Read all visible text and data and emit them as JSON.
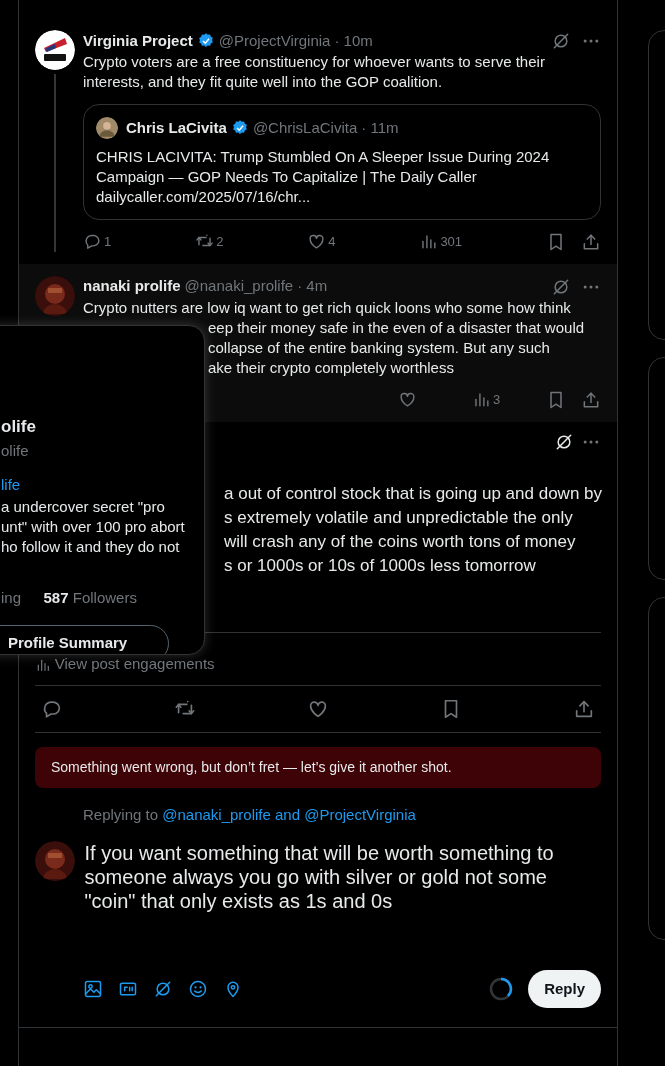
{
  "thread": [
    {
      "author": "Virginia Project",
      "verified": true,
      "handle": "@ProjectVirginia",
      "time": "· 10m",
      "highlighted": false,
      "text_lines": [
        "Crypto voters are a free constituency for whoever wants to serve their interests, and they fit quite well into the GOP coalition."
      ],
      "quote": {
        "author": "Chris LaCivita",
        "verified": true,
        "handle": "@ChrisLaCivita",
        "time": "· 11m",
        "text": "CHRIS LACIVITA: Trump Stumbled On A Sleeper Issue During 2024 Campaign — GOP Needs To Capitalize | The Daily Caller",
        "link": "dailycaller.com/2025/07/16/chr..."
      },
      "actions": [
        {
          "kind": "reply",
          "count": "1"
        },
        {
          "kind": "repost",
          "count": "2"
        },
        {
          "kind": "like",
          "count": "4"
        },
        {
          "kind": "views",
          "count": "301"
        }
      ]
    },
    {
      "author": "nanaki prolife",
      "verified": false,
      "handle": "@nanaki_prolife",
      "time": "· 4m",
      "highlighted": true,
      "text_lines": [
        "Crypto nutters are low iq want to get rich quick loons who some how think",
        "eep their money safe in the even of a disaster that would",
        "collapse of the entire banking system. But any such",
        "ake their crypto completely worthless"
      ],
      "actions": [
        {
          "kind": "like"
        },
        {
          "kind": "views",
          "count": "3"
        }
      ]
    }
  ],
  "focused_post": {
    "text_lines": [
      "a out of control stock that is going up and down by",
      "s extremely volatile and unpredictable the only",
      "will crash any of the coins worth tons of money",
      "s or 1000s or 10s of 1000s less tomorrow"
    ],
    "engagements": "View post engagements",
    "actions": [
      {
        "kind": "reply"
      },
      {
        "kind": "repost"
      },
      {
        "kind": "like"
      },
      {
        "kind": "bookmark"
      },
      {
        "kind": "share"
      }
    ]
  },
  "error_banner": "Something went wrong, but don’t fret — let’s give it another shot.",
  "composer": {
    "replying_label": "Replying to",
    "replying_to": "@nanaki_prolife and @ProjectVirginia",
    "text": "If you want something that will be worth something to someone always you go with silver or gold not some \"coin\" that only exists as 1s and 0s",
    "tools": [
      {
        "kind": "image"
      },
      {
        "kind": "gif"
      },
      {
        "kind": "grok"
      },
      {
        "kind": "emoji"
      },
      {
        "kind": "location"
      }
    ],
    "button": "Reply"
  },
  "hover_card": {
    "name": "olife",
    "handle": "olife",
    "link": "life",
    "bio_lines": [
      "a undercover secret \"pro",
      "unt\" with over 100 pro abort",
      "ho follow it and they do not"
    ],
    "following_label": "ing",
    "followers_count": "587",
    "followers_label": "Followers",
    "button": "Profile Summary"
  }
}
